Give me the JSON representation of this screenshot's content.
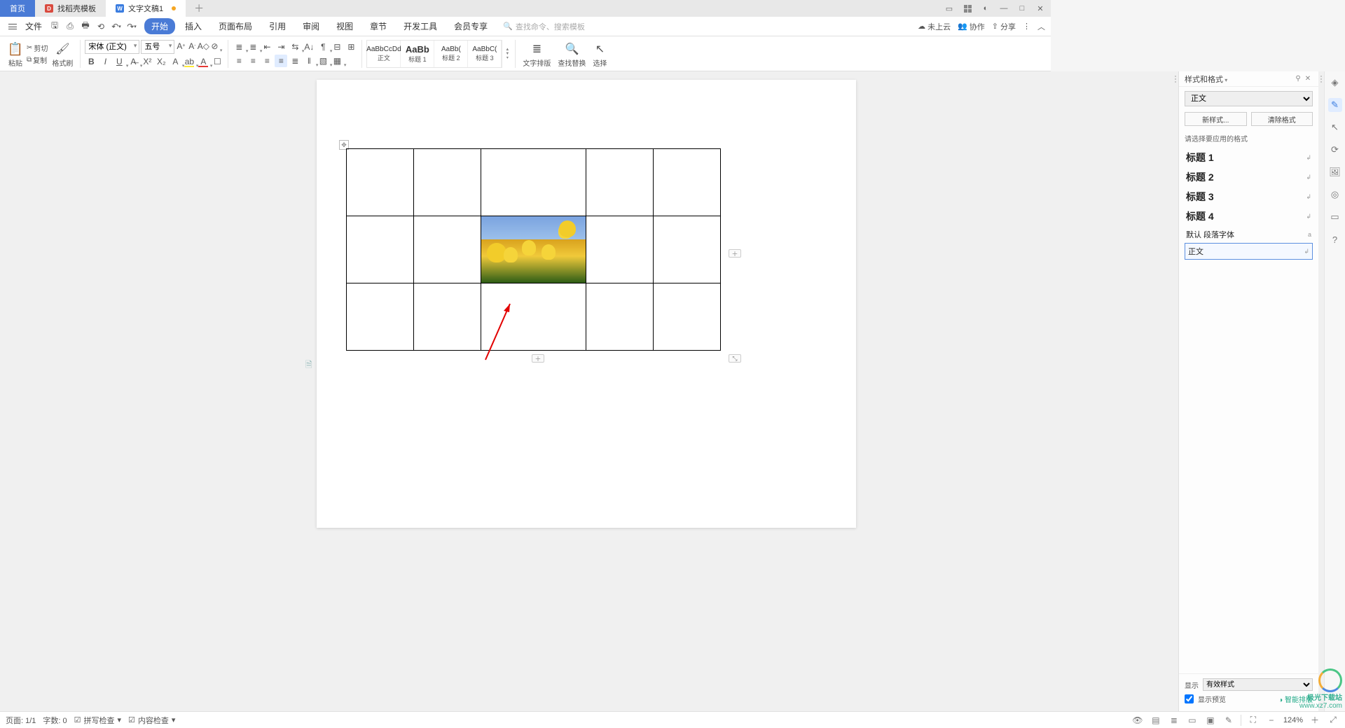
{
  "tabs": {
    "home": "首页",
    "template": "找稻壳模板",
    "doc": "文字文稿1"
  },
  "menubar": {
    "file": "文件",
    "items": [
      "开始",
      "插入",
      "页面布局",
      "引用",
      "审阅",
      "视图",
      "章节",
      "开发工具",
      "会员专享"
    ],
    "search_placeholder": "查找命令、搜索模板",
    "cloud": "未上云",
    "collab": "协作",
    "share": "分享"
  },
  "ribbon": {
    "paste": "粘贴",
    "cut": "剪切",
    "copy": "复制",
    "format_painter": "格式刷",
    "font_name": "宋体 (正文)",
    "font_size": "五号",
    "styles": [
      {
        "preview": "AaBbCcDd",
        "label": "正文"
      },
      {
        "preview": "AaBb",
        "label": "标题 1"
      },
      {
        "preview": "AaBb(",
        "label": "标题 2"
      },
      {
        "preview": "AaBbC(",
        "label": "标题 3"
      }
    ],
    "text_layout": "文字排版",
    "find_replace": "查找替换",
    "select": "选择"
  },
  "styles_panel": {
    "title": "样式和格式",
    "current": "正文",
    "new_style": "新样式...",
    "clear": "清除格式",
    "hint": "请选择要应用的格式",
    "list": [
      "标题 1",
      "标题 2",
      "标题 3",
      "标题 4"
    ],
    "default_font": "默认 段落字体",
    "body": "正文",
    "show_label": "显示",
    "show_value": "有效样式",
    "preview": "显示预览",
    "smart": "智能排版"
  },
  "status": {
    "page": "页面: 1/1",
    "words": "字数: 0",
    "spell": "拼写检查",
    "content": "内容检查",
    "zoom": "124%"
  },
  "watermark": {
    "line1": "极光下载站",
    "line2": "www.xz7.com"
  }
}
